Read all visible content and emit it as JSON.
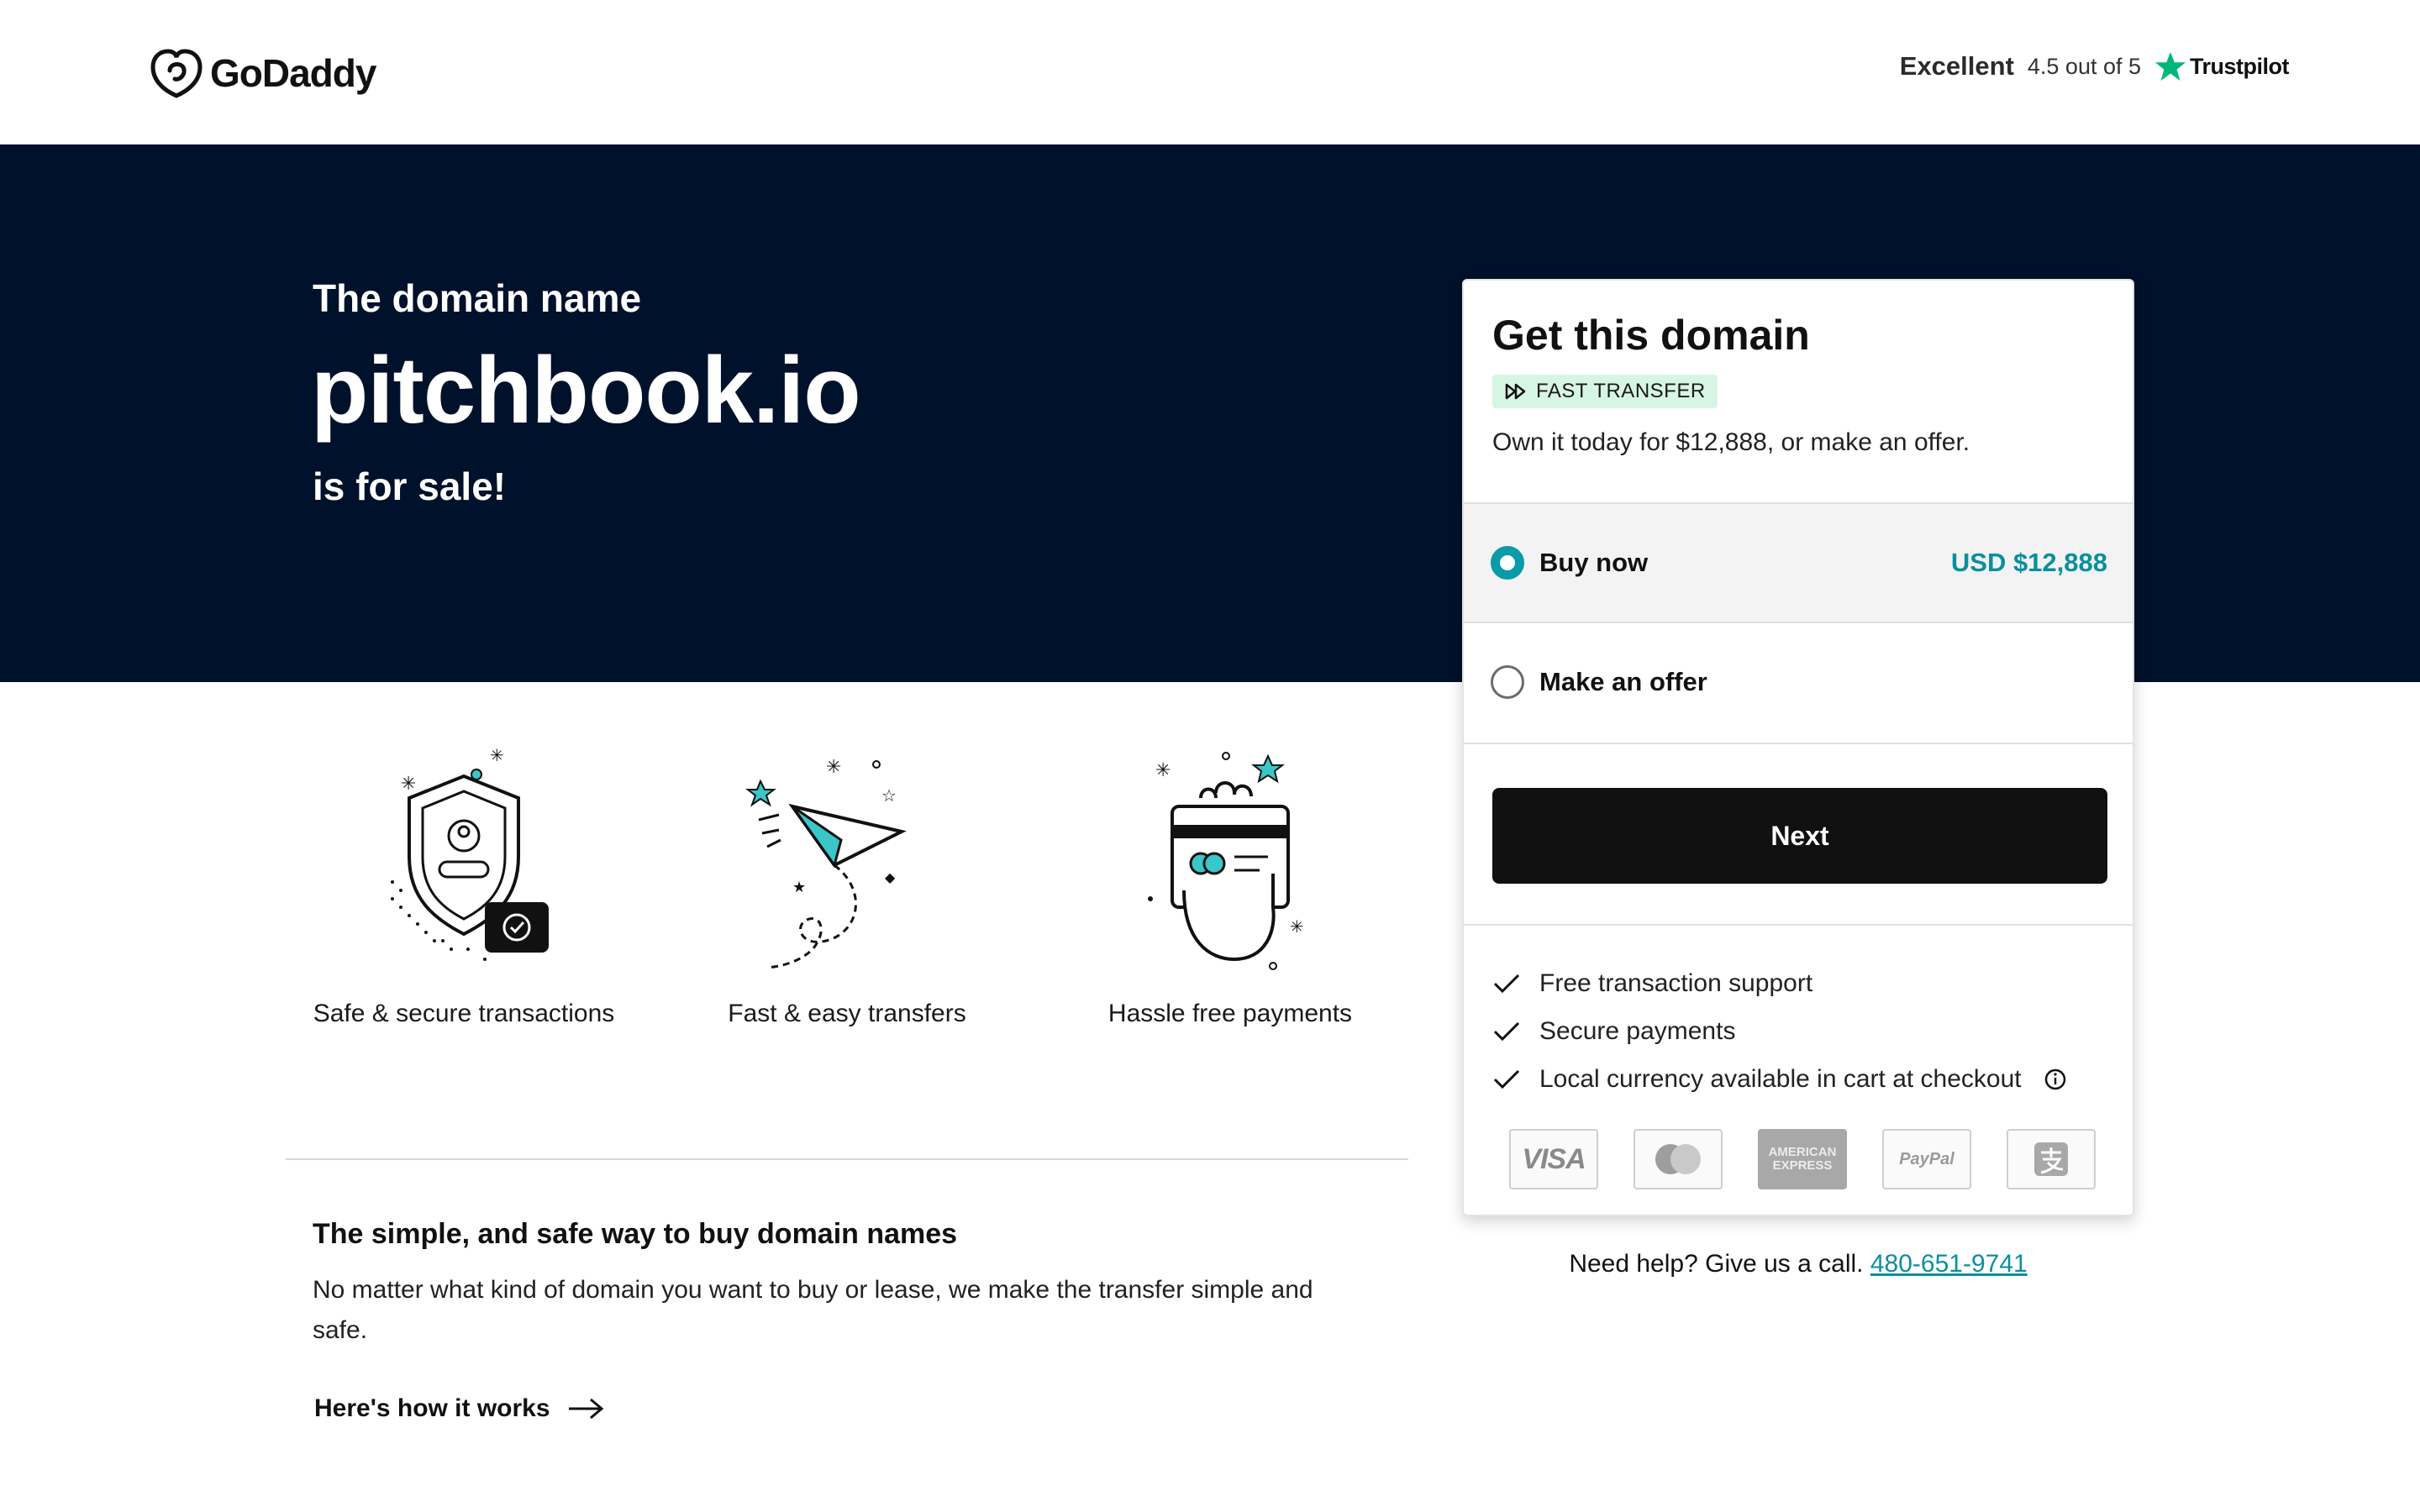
{
  "header": {
    "brand": "GoDaddy",
    "trust_label": "Excellent",
    "trust_score": "4.5 out of 5",
    "trust_brand": "Trustpilot"
  },
  "hero": {
    "kicker": "The domain name",
    "domain": "pitchbook.io",
    "sub": "is for sale!"
  },
  "features": [
    {
      "label": "Safe & secure transactions",
      "icon": "shield-check-icon"
    },
    {
      "label": "Fast & easy transfers",
      "icon": "paper-plane-icon"
    },
    {
      "label": "Hassle free payments",
      "icon": "card-hand-icon"
    }
  ],
  "info": {
    "title": "The simple, and safe way to buy domain names",
    "body": "No matter what kind of domain you want to buy or lease, we make the transfer simple and safe.",
    "link": "Here's how it works"
  },
  "card": {
    "title": "Get this domain",
    "badge": "FAST TRANSFER",
    "description": "Own it today for $12,888, or make an offer.",
    "options": [
      {
        "label": "Buy now",
        "price": "USD $12,888",
        "selected": true
      },
      {
        "label": "Make an offer",
        "price": "",
        "selected": false
      }
    ],
    "next_label": "Next",
    "checks": [
      "Free transaction support",
      "Secure payments",
      "Local currency available in cart at checkout"
    ],
    "payments": [
      "VISA",
      "MasterCard",
      "AMERICAN EXPRESS",
      "PayPal",
      "Alipay"
    ]
  },
  "help": {
    "text": "Need help? Give us a call.",
    "phone": "480-651-9741"
  },
  "colors": {
    "hero_bg": "#00112b",
    "accent_teal": "#0a9aa8",
    "button_bg": "#111111",
    "badge_bg": "#d7f5e3",
    "trustpilot_green": "#00b67a"
  }
}
